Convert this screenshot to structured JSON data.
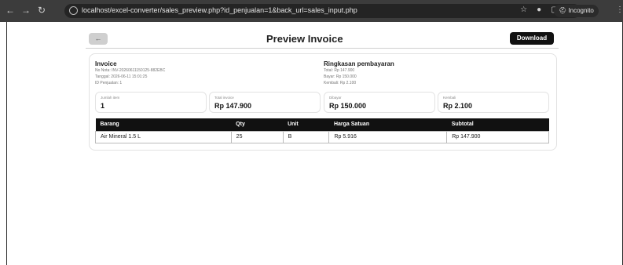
{
  "browser": {
    "url": "localhost/excel-converter/sales_preview.php?id_penjualan=1&back_url=sales_input.php",
    "incognito_label": "Incognito"
  },
  "header": {
    "back_label": "←",
    "title": "Preview Invoice",
    "download_label": "Download"
  },
  "invoice": {
    "heading": "Invoice",
    "no_nota": "No Nota: INV-20260611150125-882EBC",
    "tanggal": "Tanggal: 2026-06-11 15:01:25",
    "id_penjualan": "ID Penjualan: 1"
  },
  "summary": {
    "heading": "Ringkasan pembayaran",
    "total": "Total: Rp 147.900",
    "bayar": "Bayar: Rp 150.000",
    "kembali": "Kembali: Rp 2.100"
  },
  "stats": [
    {
      "label": "Jumlah item",
      "value": "1"
    },
    {
      "label": "Total invoice",
      "value": "Rp 147.900"
    },
    {
      "label": "Dibayar",
      "value": "Rp 150.000"
    },
    {
      "label": "Kembali",
      "value": "Rp 2.100"
    }
  ],
  "table": {
    "columns": [
      "Barang",
      "Qty",
      "Unit",
      "Harga Satuan",
      "Subtotal"
    ],
    "rows": [
      [
        "Air Mineral 1.5 L",
        "25",
        "B",
        "Rp 5.916",
        "Rp 147.900"
      ]
    ]
  }
}
